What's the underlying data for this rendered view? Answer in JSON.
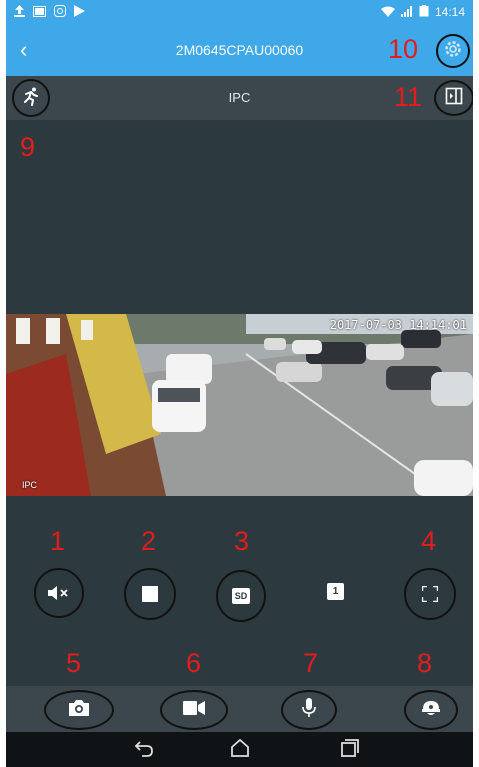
{
  "status_bar": {
    "time": "14:14",
    "left_icons": [
      "upload-icon",
      "gallery-icon",
      "instagram-icon",
      "play-store-icon"
    ],
    "right_icons": [
      "wifi-icon",
      "signal-icon",
      "battery-icon"
    ]
  },
  "header": {
    "back_glyph": "‹",
    "title": "2M0645CPAU00060",
    "settings_icon": "gear-icon"
  },
  "sub_header": {
    "title": "IPC"
  },
  "video": {
    "timestamp": "2017-07-03 14:14:01",
    "channel_label": "IPC"
  },
  "controls": {
    "quality_label": "SD",
    "channel_number": "1"
  },
  "annotations": [
    "1",
    "2",
    "3",
    "4",
    "5",
    "6",
    "7",
    "8",
    "9",
    "10",
    "11"
  ],
  "colors": {
    "accent": "#3ea8e8",
    "annotation": "#e31c1c",
    "panel": "#2c3a40"
  }
}
